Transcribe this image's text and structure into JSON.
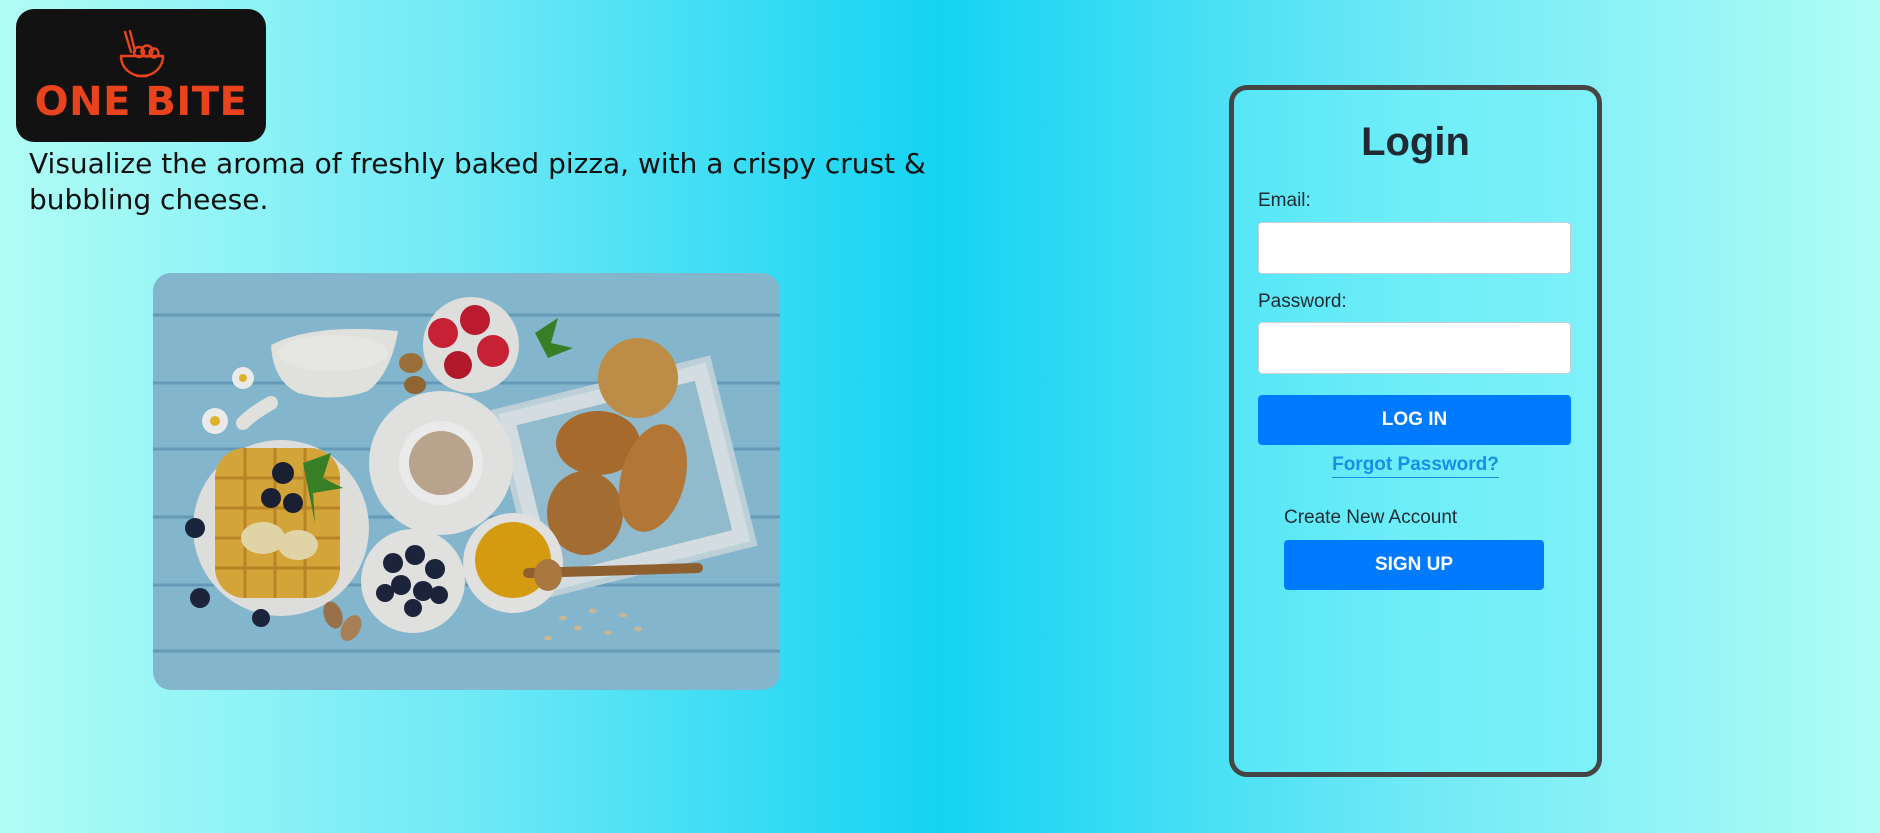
{
  "brand": {
    "name": "ONE BITE",
    "logo_icon": "noodle-bowl-icon",
    "logo_color": "#e8431c",
    "logo_background": "#121212"
  },
  "tagline": "Visualize the aroma of freshly baked pizza, with a crispy crust & bubbling cheese.",
  "hero_image": {
    "subject": "breakfast-spread-photo"
  },
  "login": {
    "title": "Login",
    "email_label": "Email:",
    "email_value": "",
    "password_label": "Password:",
    "password_value": "",
    "login_button": "LOG IN",
    "forgot_password": "Forgot Password?",
    "create_account_label": "Create New Account",
    "signup_button": "SIGN UP"
  },
  "colors": {
    "primary_button": "#007bff",
    "link": "#1590e8",
    "card_border": "#454545",
    "background_center": "#14d3f2",
    "background_edge": "#b0fdf5"
  }
}
